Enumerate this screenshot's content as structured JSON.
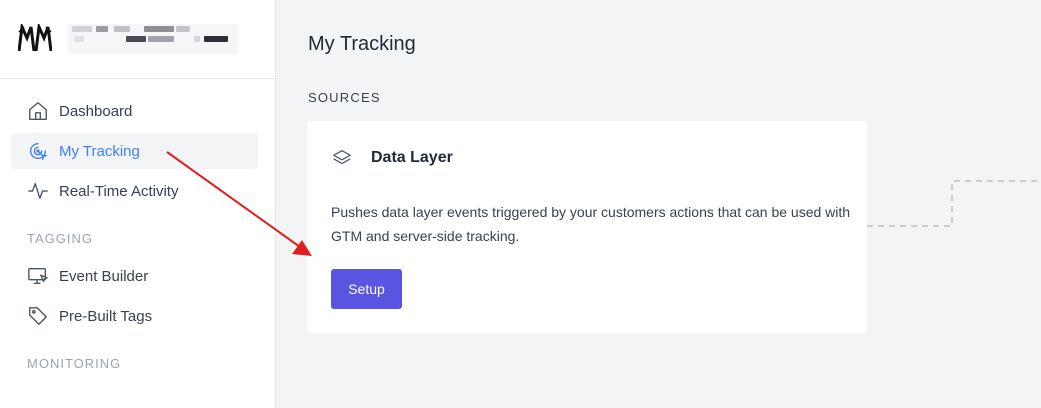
{
  "sidebar": {
    "items": [
      {
        "label": "Dashboard",
        "icon": "home-icon",
        "active": false
      },
      {
        "label": "My Tracking",
        "icon": "target-icon",
        "active": true
      },
      {
        "label": "Real-Time Activity",
        "icon": "activity-icon",
        "active": false
      }
    ],
    "tagging": {
      "heading": "TAGGING",
      "items": [
        {
          "label": "Event Builder",
          "icon": "monitor-icon"
        },
        {
          "label": "Pre-Built Tags",
          "icon": "tag-icon"
        }
      ]
    },
    "monitoring": {
      "heading": "MONITORING"
    }
  },
  "main": {
    "title": "My Tracking",
    "sources_label": "SOURCES",
    "card": {
      "icon": "layers-icon",
      "title": "Data Layer",
      "description": "Pushes data layer events triggered by your customers actions that can be used with GTM and server-side tracking.",
      "button_label": "Setup"
    }
  },
  "colors": {
    "accent": "#3b82f6",
    "button": "#5a55e0",
    "annotation_arrow": "#e0201c"
  }
}
